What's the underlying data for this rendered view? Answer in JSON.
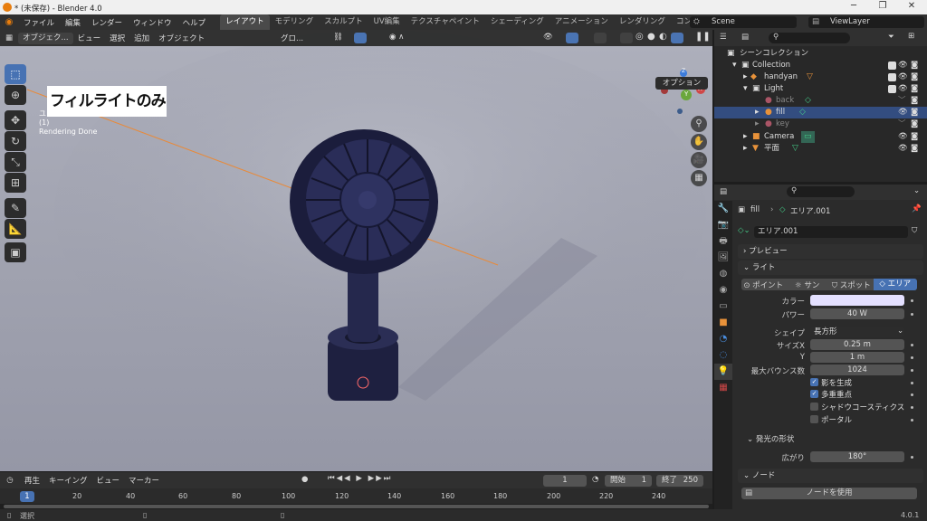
{
  "window": {
    "title": "* (未保存) - Blender 4.0"
  },
  "menu": {
    "items": [
      "ファイル",
      "編集",
      "レンダー",
      "ウィンドウ",
      "ヘルプ"
    ],
    "workspaces": [
      "レイアウト",
      "モデリング",
      "スカルプト",
      "UV編集",
      "テクスチャペイント",
      "シェーディング",
      "アニメーション",
      "レンダリング",
      "コンポジティング"
    ],
    "scene": "Scene",
    "viewlayer": "ViewLayer"
  },
  "viewport": {
    "mode": "オブジェク...",
    "menus": [
      "ビュー",
      "選択",
      "追加",
      "オブジェクト"
    ],
    "transform": "グロ...",
    "options": "オプション",
    "caption": "フィルライトのみ",
    "info_line1": "ユ",
    "info_line2": "(1)",
    "info_line3": "Rendering Done",
    "gizmo": {
      "z": "Z",
      "x": "X",
      "y": "Y"
    }
  },
  "timeline": {
    "menus": [
      "再生",
      "キーイング",
      "ビュー",
      "マーカー"
    ],
    "current_frame": "1",
    "start_label": "開始",
    "start": "1",
    "end_label": "終了",
    "end": "250",
    "ticks": [
      "1",
      "20",
      "40",
      "60",
      "80",
      "100",
      "120",
      "140",
      "160",
      "180",
      "200",
      "220",
      "240"
    ]
  },
  "status": {
    "select": "選択",
    "version": "4.0.1"
  },
  "outliner": {
    "scene_collection": "シーンコレクション",
    "rows": [
      {
        "label": "Collection"
      },
      {
        "label": "handyan"
      },
      {
        "label": "Light"
      },
      {
        "label": "back"
      },
      {
        "label": "fill"
      },
      {
        "label": "key"
      },
      {
        "label": "Camera"
      },
      {
        "label": "平面"
      }
    ]
  },
  "properties": {
    "object": "fill",
    "data": "エリア.001",
    "datablock": "エリア.001",
    "preview": "プレビュー",
    "light": "ライト",
    "types": [
      "ポイント",
      "サン",
      "スポット",
      "エリア"
    ],
    "color_label": "カラー",
    "color": "#e4e0ff",
    "power_label": "パワー",
    "power": "40 W",
    "shape_label": "シェイプ",
    "shape": "長方形",
    "sizex_label": "サイズX",
    "sizex": "0.25 m",
    "y_label": "Y",
    "y": "1 m",
    "bounce_label": "最大バウンス数",
    "bounce": "1024",
    "cast_shadow": "影を生成",
    "multiple_importance": "多重重点",
    "shadow_caustics": "シャドウコースティクス",
    "portal": "ポータル",
    "beam_shape": "発光の形状",
    "spread_label": "広がり",
    "spread": "180°",
    "nodes": "ノード",
    "use_nodes": "ノードを使用"
  }
}
